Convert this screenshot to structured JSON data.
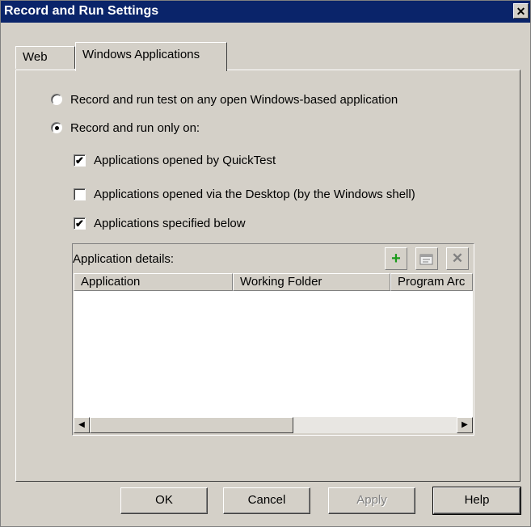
{
  "window": {
    "title": "Record and Run Settings",
    "close_glyph": "✕"
  },
  "tabs": [
    {
      "label": "Web",
      "active": false
    },
    {
      "label": "Windows Applications",
      "active": true
    }
  ],
  "options": {
    "radio_any": {
      "label": "Record and run test on any open Windows-based application",
      "checked": false
    },
    "radio_only": {
      "label": "Record and run only on:",
      "checked": true
    },
    "checkboxes": [
      {
        "label": "Applications opened by QuickTest",
        "checked": true
      },
      {
        "label": "Applications opened via the Desktop (by the Windows shell)",
        "checked": false
      },
      {
        "label": "Applications specified below",
        "checked": true
      }
    ]
  },
  "details": {
    "label": "Application details:",
    "toolbar": {
      "add_icon": "+",
      "edit_icon": "edit-icon",
      "delete_icon": "✕"
    },
    "columns": [
      "Application",
      "Working Folder",
      "Program Arc"
    ],
    "rows": [],
    "scroll_left": "◀",
    "scroll_right": "▶"
  },
  "buttons": {
    "ok": "OK",
    "cancel": "Cancel",
    "apply": "Apply",
    "help": "Help"
  },
  "check_glyph": "✔"
}
